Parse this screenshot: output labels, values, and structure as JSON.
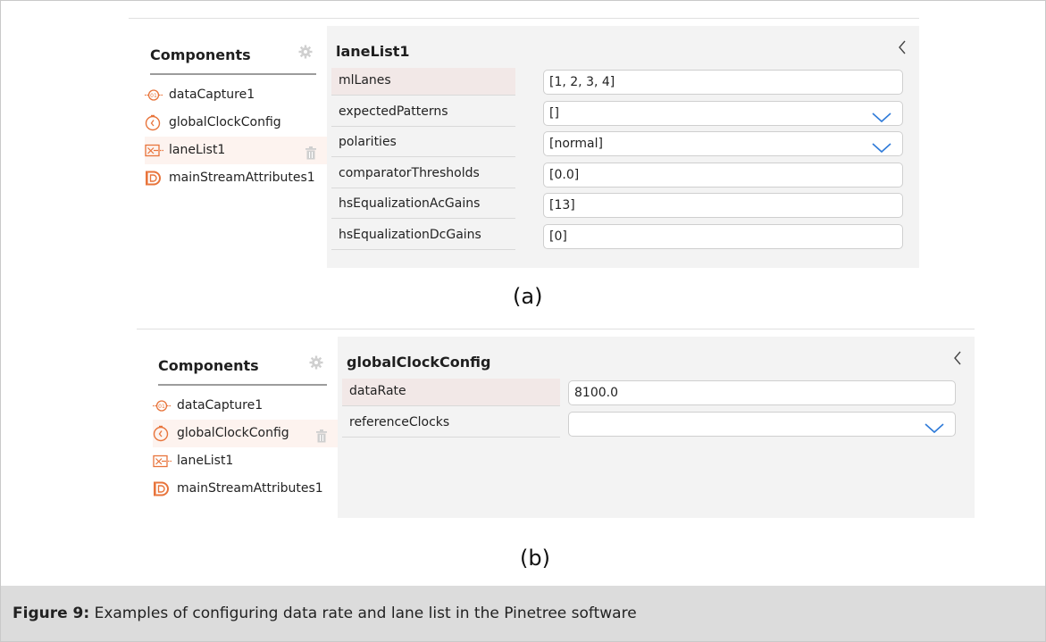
{
  "panel_a": {
    "sidebar": {
      "title": "Components",
      "items": [
        {
          "label": "dataCapture1",
          "icon": "data-capture-icon",
          "selected": false
        },
        {
          "label": "globalClockConfig",
          "icon": "clock-icon",
          "selected": false
        },
        {
          "label": "laneList1",
          "icon": "lane-list-icon",
          "selected": true
        },
        {
          "label": "mainStreamAttributes1",
          "icon": "main-stream-icon",
          "selected": false
        }
      ]
    },
    "properties": {
      "title": "laneList1",
      "rows": [
        {
          "label": "mlLanes",
          "value": "[1, 2, 3, 4]",
          "dropdown": false
        },
        {
          "label": "expectedPatterns",
          "value": "[]",
          "dropdown": true
        },
        {
          "label": "polarities",
          "value": "[normal]",
          "dropdown": true
        },
        {
          "label": "comparatorThresholds",
          "value": "[0.0]",
          "dropdown": false
        },
        {
          "label": "hsEqualizationAcGains",
          "value": "[13]",
          "dropdown": false
        },
        {
          "label": "hsEqualizationDcGains",
          "value": "[0]",
          "dropdown": false
        }
      ]
    },
    "caption": "(a)"
  },
  "panel_b": {
    "sidebar": {
      "title": "Components",
      "items": [
        {
          "label": "dataCapture1",
          "icon": "data-capture-icon",
          "selected": false
        },
        {
          "label": "globalClockConfig",
          "icon": "clock-icon",
          "selected": true
        },
        {
          "label": "laneList1",
          "icon": "lane-list-icon",
          "selected": false
        },
        {
          "label": "mainStreamAttributes1",
          "icon": "main-stream-icon",
          "selected": false
        }
      ]
    },
    "properties": {
      "title": "globalClockConfig",
      "rows": [
        {
          "label": "dataRate",
          "value": "8100.0",
          "dropdown": false
        },
        {
          "label": "referenceClocks",
          "value": "",
          "dropdown": true
        }
      ]
    },
    "caption": "(b)"
  },
  "figure_caption": {
    "label": "Figure 9:",
    "text": " Examples of configuring data rate and lane list in the Pinetree software"
  },
  "colors": {
    "accent_orange": "#e8743b",
    "dropdown_blue": "#2f7bd9",
    "selected_bg": "#fdf3ef",
    "panel_bg": "#f3f3f3",
    "caption_bg": "#dcdcdc"
  }
}
